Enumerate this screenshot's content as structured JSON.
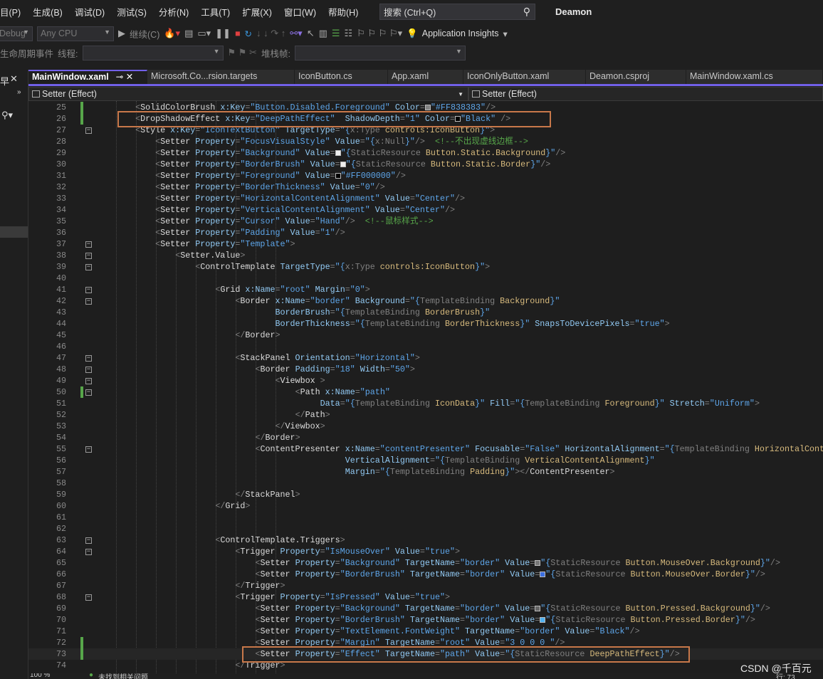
{
  "menubar": {
    "items": [
      "目(P)",
      "生成(B)",
      "调试(D)",
      "测试(S)",
      "分析(N)",
      "工具(T)",
      "扩展(X)",
      "窗口(W)",
      "帮助(H)"
    ],
    "search_placeholder": "搜索 (Ctrl+Q)",
    "solution_title": "Deamon"
  },
  "toolbar": {
    "config": "Debug",
    "platform": "Any CPU",
    "continue_label": "继续(C)",
    "app_insights": "Application Insights",
    "lifecycle_label": "生命周期事件",
    "thread_label": "线程:",
    "stackframe_label": "堆栈帧:"
  },
  "tabs": [
    {
      "label": "MainWindow.xaml",
      "active": true
    },
    {
      "label": "Microsoft.Co...rsion.targets"
    },
    {
      "label": "IconButton.cs"
    },
    {
      "label": "App.xaml"
    },
    {
      "label": "IconOnlyButton.xaml"
    },
    {
      "label": "Deamon.csproj"
    },
    {
      "label": "MainWindow.xaml.cs"
    }
  ],
  "navbar": {
    "left": "Setter (Effect)",
    "right": "Setter (Effect)"
  },
  "editor": {
    "lines": [
      {
        "n": "25",
        "chg": true,
        "code": "    <SolidColorBrush x:Key=\"Button.Disabled.Foreground\" Color=■\"#FF838383\"/>",
        "swatch": "#838383"
      },
      {
        "n": "26",
        "chg": true,
        "code": "    <DropShadowEffect x:Key=\"DeepPathEffect\"  ShadowDepth=\"1\" Color=■\"Black\" />",
        "swatch": "#000000"
      },
      {
        "n": "27",
        "fold": true,
        "code": "    <Style x:Key=\"IconTextButton\" TargetType=\"{x:Type controls:IconButton}\">"
      },
      {
        "n": "28",
        "code": "        <Setter Property=\"FocusVisualStyle\" Value=\"{x:Null}\"/>  <!--不出现虚线边框-->"
      },
      {
        "n": "29",
        "code": "        <Setter Property=\"Background\" Value=■\"{StaticResource Button.Static.Background}\"/>",
        "swatch": "#eeeeee"
      },
      {
        "n": "30",
        "code": "        <Setter Property=\"BorderBrush\" Value=■\"{StaticResource Button.Static.Border}\"/>",
        "swatch": "#eeeeee"
      },
      {
        "n": "31",
        "code": "        <Setter Property=\"Foreground\" Value=■\"#FF000000\"/>",
        "swatch": "#000000"
      },
      {
        "n": "32",
        "code": "        <Setter Property=\"BorderThickness\" Value=\"0\"/>"
      },
      {
        "n": "33",
        "code": "        <Setter Property=\"HorizontalContentAlignment\" Value=\"Center\"/>"
      },
      {
        "n": "34",
        "code": "        <Setter Property=\"VerticalContentAlignment\" Value=\"Center\"/>"
      },
      {
        "n": "35",
        "code": "        <Setter Property=\"Cursor\" Value=\"Hand\"/>  <!--鼠标样式-->"
      },
      {
        "n": "36",
        "code": "        <Setter Property=\"Padding\" Value=\"1\"/>"
      },
      {
        "n": "37",
        "fold": true,
        "code": "        <Setter Property=\"Template\">"
      },
      {
        "n": "38",
        "fold": true,
        "code": "            <Setter.Value>"
      },
      {
        "n": "39",
        "fold": true,
        "code": "                <ControlTemplate TargetType=\"{x:Type controls:IconButton}\">"
      },
      {
        "n": "40",
        "code": ""
      },
      {
        "n": "41",
        "fold": true,
        "code": "                    <Grid x:Name=\"root\" Margin=\"0\">"
      },
      {
        "n": "42",
        "fold": true,
        "code": "                        <Border x:Name=\"border\" Background=\"{TemplateBinding Background}\""
      },
      {
        "n": "43",
        "code": "                                BorderBrush=\"{TemplateBinding BorderBrush}\""
      },
      {
        "n": "44",
        "code": "                                BorderThickness=\"{TemplateBinding BorderThickness}\" SnapsToDevicePixels=\"true\">"
      },
      {
        "n": "45",
        "code": "                        </Border>"
      },
      {
        "n": "46",
        "code": ""
      },
      {
        "n": "47",
        "fold": true,
        "code": "                        <StackPanel Orientation=\"Horizontal\">"
      },
      {
        "n": "48",
        "fold": true,
        "code": "                            <Border Padding=\"18\" Width=\"50\">"
      },
      {
        "n": "49",
        "fold": true,
        "code": "                                <Viewbox >"
      },
      {
        "n": "50",
        "fold": true,
        "chg": true,
        "code": "                                    <Path x:Name=\"path\""
      },
      {
        "n": "51",
        "code": "                                         Data=\"{TemplateBinding IconData}\" Fill=\"{TemplateBinding Foreground}\" Stretch=\"Uniform\">"
      },
      {
        "n": "52",
        "code": "                                    </Path>"
      },
      {
        "n": "53",
        "code": "                                </Viewbox>"
      },
      {
        "n": "54",
        "code": "                            </Border>"
      },
      {
        "n": "55",
        "fold": true,
        "code": "                            <ContentPresenter x:Name=\"contentPresenter\" Focusable=\"False\" HorizontalAlignment=\"{TemplateBinding HorizontalContentAlignment}\""
      },
      {
        "n": "56",
        "code": "                                              VerticalAlignment=\"{TemplateBinding VerticalContentAlignment}\""
      },
      {
        "n": "57",
        "code": "                                              Margin=\"{TemplateBinding Padding}\"></ContentPresenter>"
      },
      {
        "n": "58",
        "code": ""
      },
      {
        "n": "59",
        "code": "                        </StackPanel>"
      },
      {
        "n": "60",
        "code": "                    </Grid>"
      },
      {
        "n": "61",
        "code": ""
      },
      {
        "n": "62",
        "code": ""
      },
      {
        "n": "63",
        "fold": true,
        "code": "                    <ControlTemplate.Triggers>"
      },
      {
        "n": "64",
        "fold": true,
        "code": "                        <Trigger Property=\"IsMouseOver\" Value=\"true\">"
      },
      {
        "n": "65",
        "code": "                            <Setter Property=\"Background\" TargetName=\"border\" Value=■\"{StaticResource Button.MouseOver.Background}\"/>",
        "swatch": "#777777"
      },
      {
        "n": "66",
        "code": "                            <Setter Property=\"BorderBrush\" TargetName=\"border\" Value=■\"{StaticResource Button.MouseOver.Border}\"/>",
        "swatch": "#3c6fe0"
      },
      {
        "n": "67",
        "code": "                        </Trigger>"
      },
      {
        "n": "68",
        "fold": true,
        "code": "                        <Trigger Property=\"IsPressed\" Value=\"true\">"
      },
      {
        "n": "69",
        "code": "                            <Setter Property=\"Background\" TargetName=\"border\" Value=■\"{StaticResource Button.Pressed.Background}\"/>",
        "swatch": "#666666"
      },
      {
        "n": "70",
        "code": "                            <Setter Property=\"BorderBrush\" TargetName=\"border\" Value=■\"{StaticResource Button.Pressed.Border}\"/>",
        "swatch": "#4fb0f0"
      },
      {
        "n": "71",
        "code": "                            <Setter Property=\"TextElement.FontWeight\" TargetName=\"border\" Value=\"Black\"/>"
      },
      {
        "n": "72",
        "chg": true,
        "code": "                            <Setter Property=\"Margin\" TargetName=\"root\" Value=\"3 0 0 0 \"/>"
      },
      {
        "n": "73",
        "chg": true,
        "current": true,
        "code": "                            <Setter Property=\"Effect\" TargetName=\"path\" Value=\"{StaticResource DeepPathEffect}\"/>"
      },
      {
        "n": "74",
        "code": "                        </Trigger>"
      }
    ]
  },
  "status": {
    "zoom": "100 %",
    "issues": "未找到相关问题",
    "line": "行: 73"
  },
  "watermark": "CSDN @千百元",
  "colors": {
    "accent": "#7160e8",
    "highlight_box": "#c8784a",
    "changed": "#57a64a"
  }
}
